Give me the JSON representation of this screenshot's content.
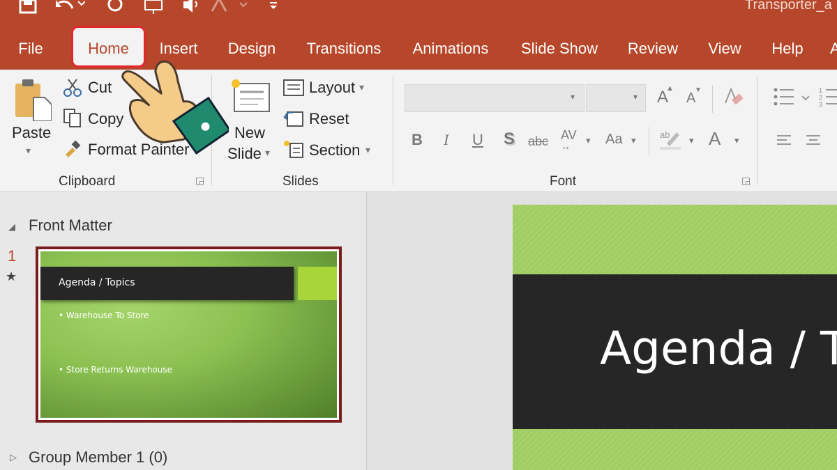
{
  "window": {
    "title": "Transporter_a"
  },
  "tabs": [
    "File",
    "Home",
    "Insert",
    "Design",
    "Transitions",
    "Animations",
    "Slide Show",
    "Review",
    "View",
    "Help"
  ],
  "clipboard": {
    "paste": "Paste",
    "cut": "Cut",
    "copy": "Copy",
    "format_painter": "Format Painter",
    "group_label": "Clipboard"
  },
  "slides_group": {
    "new_slide_line1": "New",
    "new_slide_line2": "Slide",
    "layout": "Layout",
    "reset": "Reset",
    "section": "Section",
    "group_label": "Slides"
  },
  "font_group": {
    "group_label": "Font",
    "grow": "A",
    "shrink": "A",
    "bold": "B",
    "italic": "I",
    "underline": "U",
    "shadow": "S",
    "strikethrough": "abc",
    "spacing": "AV",
    "change_case": "Aa",
    "font_color": "A"
  },
  "outline": {
    "section1": "Front Matter",
    "slide_number": "1",
    "section2": "Group Member 1 (0)"
  },
  "slide": {
    "title": "Agenda / Topics",
    "bullet1": "• Warehouse To Store",
    "bullet2": "• Store Returns Warehouse",
    "editor_title": "Agenda / T"
  },
  "colors": {
    "accent": "#b7472a",
    "home_highlight": "#e0282d",
    "slide_green": "#8cc152",
    "title_bar": "#262626"
  }
}
